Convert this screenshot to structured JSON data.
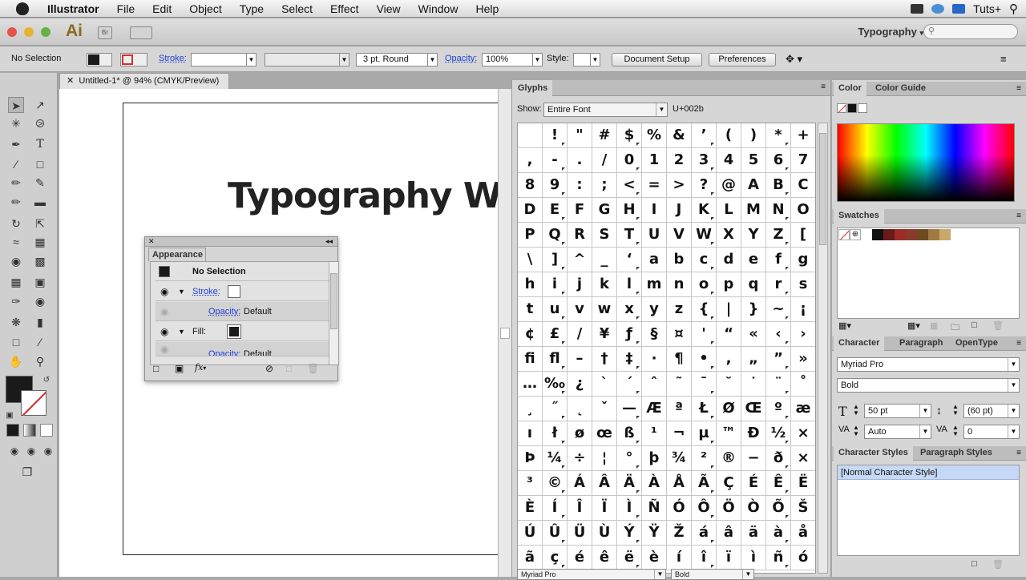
{
  "menubar": {
    "app": "Illustrator",
    "items": [
      "File",
      "Edit",
      "Object",
      "Type",
      "Select",
      "Effect",
      "View",
      "Window",
      "Help"
    ],
    "right_label": "Tuts+"
  },
  "appbar": {
    "logo": "Ai",
    "bridge": "Br",
    "workspace": "Typography",
    "workspace_arrow": "▾",
    "search_placeholder": ""
  },
  "control": {
    "selection": "No Selection",
    "stroke_label": "Stroke:",
    "brush": "3 pt. Round",
    "opacity_label": "Opacity:",
    "opacity_value": "100%",
    "style_label": "Style:",
    "doc_setup": "Document Setup",
    "preferences": "Preferences"
  },
  "document": {
    "tab": "Untitled-1* @ 94% (CMYK/Preview)",
    "art_text": "Typography Wor"
  },
  "appearance": {
    "title": "Appearance",
    "no_selection": "No Selection",
    "stroke_label": "Stroke:",
    "opacity_label": "Opacity:",
    "opacity_value": "Default",
    "fill_label": "Fill:",
    "opacity2_label": "Opacity:",
    "opacity2_value": "Default",
    "fx": "fx"
  },
  "glyphs": {
    "title": "Glyphs",
    "show_label": "Show:",
    "show_value": "Entire Font",
    "unicode": "U+002b",
    "font": "Myriad Pro",
    "style": "Bold",
    "cells": [
      " ",
      "!",
      "\"",
      "#",
      "$",
      "%",
      "&",
      "’",
      "(",
      ")",
      "*",
      "+",
      ",",
      "-",
      ".",
      "/",
      "0",
      "1",
      "2",
      "3",
      "4",
      "5",
      "6",
      "7",
      "8",
      "9",
      ":",
      ";",
      "<",
      "=",
      ">",
      "?",
      "@",
      "A",
      "B",
      "C",
      "D",
      "E",
      "F",
      "G",
      "H",
      "I",
      "J",
      "K",
      "L",
      "M",
      "N",
      "O",
      "P",
      "Q",
      "R",
      "S",
      "T",
      "U",
      "V",
      "W",
      "X",
      "Y",
      "Z",
      "[",
      "\\",
      "]",
      "^",
      "_",
      "‘",
      "a",
      "b",
      "c",
      "d",
      "e",
      "f",
      "g",
      "h",
      "i",
      "j",
      "k",
      "l",
      "m",
      "n",
      "o",
      "p",
      "q",
      "r",
      "s",
      "t",
      "u",
      "v",
      "w",
      "x",
      "y",
      "z",
      "{",
      "|",
      "}",
      "~",
      "¡",
      "¢",
      "£",
      "/",
      "¥",
      "ƒ",
      "§",
      "¤",
      "'",
      "“",
      "«",
      "‹",
      "›",
      "ﬁ",
      "ﬂ",
      "–",
      "†",
      "‡",
      "·",
      "¶",
      "•",
      ",",
      "„",
      "”",
      "»",
      "…",
      "‰",
      "¿",
      "`",
      "´",
      "ˆ",
      "˜",
      "¯",
      "˘",
      "˙",
      "¨",
      "˚",
      "¸",
      "˝",
      "˛",
      "ˇ",
      "—",
      "Æ",
      "ª",
      "Ł",
      "Ø",
      "Œ",
      "º",
      "æ",
      "ı",
      "ł",
      "ø",
      "œ",
      "ß",
      "¹",
      "¬",
      "µ",
      "™",
      "Ð",
      "½",
      "×",
      "Þ",
      "¼",
      "÷",
      "¦",
      "°",
      "þ",
      "¾",
      "²",
      "®",
      "−",
      "ð",
      "×",
      "³",
      "©",
      "Á",
      "Â",
      "Ä",
      "À",
      "Å",
      "Ã",
      "Ç",
      "É",
      "Ê",
      "Ë",
      "È",
      "Í",
      "Î",
      "Ï",
      "Ì",
      "Ñ",
      "Ó",
      "Ô",
      "Ö",
      "Ò",
      "Õ",
      "Š",
      "Ú",
      "Û",
      "Ü",
      "Ù",
      "Ý",
      "Ÿ",
      "Ž",
      "á",
      "â",
      "ä",
      "à",
      "å",
      "ã",
      "ç",
      "é",
      "ê",
      "ë",
      "è",
      "í",
      "î",
      "ï",
      "ì",
      "ñ",
      "ó"
    ]
  },
  "color_panel": {
    "tab1": "Color",
    "tab2": "Color Guide"
  },
  "swatches": {
    "title": "Swatches",
    "colors": [
      "#ffffff",
      "#111111",
      "#6b1a1a",
      "#9e2a2a",
      "#8a3a2a",
      "#6e4a20",
      "#a07a40",
      "#c9a86a"
    ]
  },
  "character": {
    "tab1": "Character",
    "tab2": "Paragraph",
    "tab3": "OpenType",
    "font": "Myriad Pro",
    "style": "Bold",
    "size": "50 pt",
    "leading": "(60 pt)",
    "kerning": "Auto",
    "tracking": "0"
  },
  "char_styles": {
    "tab1": "Character Styles",
    "tab2": "Paragraph Styles",
    "item": "[Normal Character Style]"
  }
}
